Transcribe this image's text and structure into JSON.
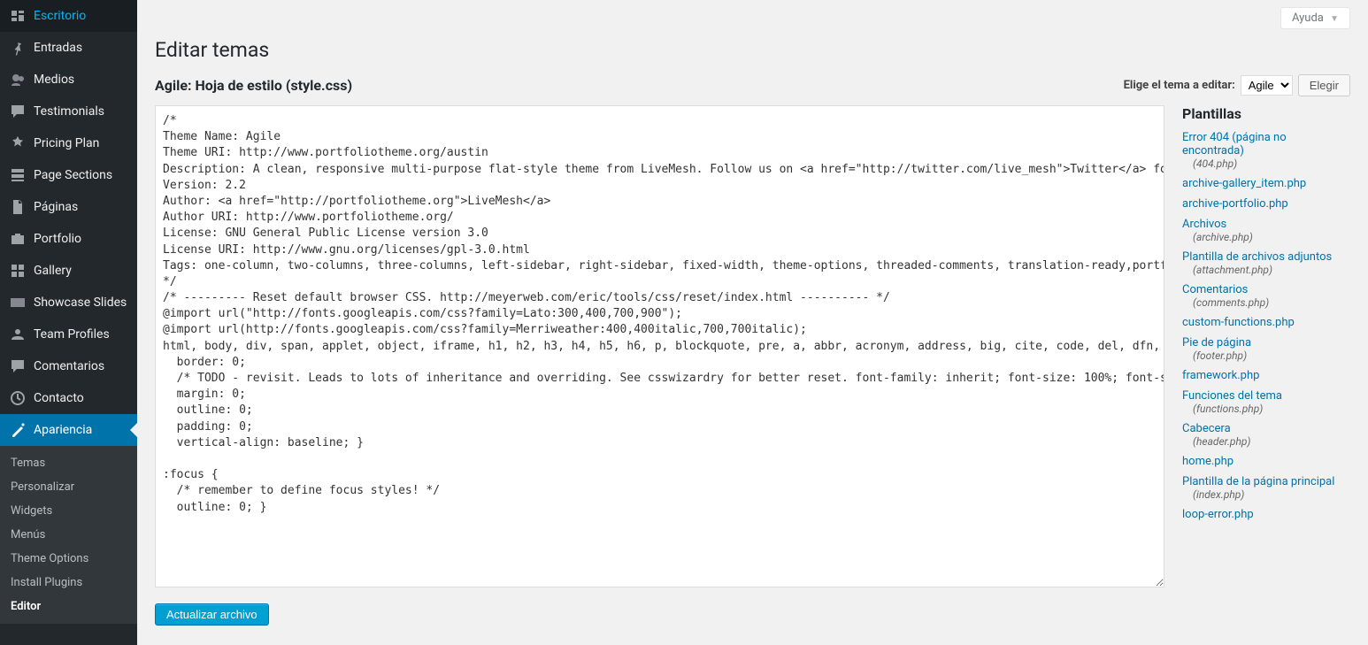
{
  "help_tab": "Ayuda",
  "page_title": "Editar temas",
  "file_heading": "Agile: Hoja de estilo (style.css)",
  "theme_selector": {
    "label": "Elige el tema a editar:",
    "selected": "Agile",
    "button": "Elegir"
  },
  "editor_content": "/*\nTheme Name: Agile\nTheme URI: http://www.portfoliotheme.org/austin\nDescription: A clean, responsive multi-purpose flat-style theme from LiveMesh. Follow us on <a href=\"http://twitter.com/live_mesh\">Twitter</a> for updates\nVersion: 2.2\nAuthor: <a href=\"http://portfoliotheme.org\">LiveMesh</a>\nAuthor URI: http://www.portfoliotheme.org/\nLicense: GNU General Public License version 3.0\nLicense URI: http://www.gnu.org/licenses/gpl-3.0.html\nTags: one-column, two-columns, three-columns, left-sidebar, right-sidebar, fixed-width, theme-options, threaded-comments, translation-ready,portfolio,mobile,app,one-page,single-page,ios,android,tags\n*/\n/* --------- Reset default browser CSS. http://meyerweb.com/eric/tools/css/reset/index.html ---------- */\n@import url(\"http://fonts.googleapis.com/css?family=Lato:300,400,700,900\");\n@import url(http://fonts.googleapis.com/css?family=Merriweather:400,400italic,700,700italic);\nhtml, body, div, span, applet, object, iframe, h1, h2, h3, h4, h5, h6, p, blockquote, pre, a, abbr, acronym, address, big, cite, code, del, dfn, em, font, ins, kbd, q, s, samp, small, strike, strong, sub, sup, tt, var, dl, dt, dd, ol, ul, li, fieldset, form, label, legend, table, caption, tbody, tfoot, thead, tr, th, td, article, aside, canvas, details, figcaption, figure, footer, header, hgroup, menu, nav, section, summary, time, mark, audio, video {\n  border: 0;\n  /* TODO - revisit. Leads to lots of inheritance and overriding. See csswizardry for better reset. font-family: inherit; font-size: 100%; font-style: inherit; font-weight: inherit; */\n  margin: 0;\n  outline: 0;\n  padding: 0;\n  vertical-align: baseline; }\n\n:focus {\n  /* remember to define focus styles! */\n  outline: 0; }",
  "update_button": "Actualizar archivo",
  "sidebar": {
    "items": [
      {
        "label": "Escritorio",
        "icon": "dashboard"
      },
      {
        "label": "Entradas",
        "icon": "pin"
      },
      {
        "label": "Medios",
        "icon": "media"
      },
      {
        "label": "Testimonials",
        "icon": "testimonial"
      },
      {
        "label": "Pricing Plan",
        "icon": "pricing"
      },
      {
        "label": "Page Sections",
        "icon": "sections"
      },
      {
        "label": "Páginas",
        "icon": "page"
      },
      {
        "label": "Portfolio",
        "icon": "portfolio"
      },
      {
        "label": "Gallery",
        "icon": "gallery"
      },
      {
        "label": "Showcase Slides",
        "icon": "slides"
      },
      {
        "label": "Team Profiles",
        "icon": "team"
      },
      {
        "label": "Comentarios",
        "icon": "comments"
      },
      {
        "label": "Contacto",
        "icon": "contact"
      },
      {
        "label": "Apariencia",
        "icon": "appearance",
        "current": true
      }
    ],
    "submenu": [
      {
        "label": "Temas"
      },
      {
        "label": "Personalizar"
      },
      {
        "label": "Widgets"
      },
      {
        "label": "Menús"
      },
      {
        "label": "Theme Options"
      },
      {
        "label": "Install Plugins"
      },
      {
        "label": "Editor",
        "current": true
      }
    ]
  },
  "templates": {
    "heading": "Plantillas",
    "items": [
      {
        "label": "Error 404 (página no encontrada)",
        "file": "(404.php)"
      },
      {
        "label": "archive-gallery_item.php"
      },
      {
        "label": "archive-portfolio.php"
      },
      {
        "label": "Archivos",
        "file": "(archive.php)"
      },
      {
        "label": "Plantilla de archivos adjuntos",
        "file": "(attachment.php)"
      },
      {
        "label": "Comentarios",
        "file": "(comments.php)"
      },
      {
        "label": "custom-functions.php"
      },
      {
        "label": "Pie de página",
        "file": "(footer.php)"
      },
      {
        "label": "framework.php"
      },
      {
        "label": "Funciones del tema",
        "file": "(functions.php)"
      },
      {
        "label": "Cabecera",
        "file": "(header.php)"
      },
      {
        "label": "home.php"
      },
      {
        "label": "Plantilla de la página principal",
        "file": "(index.php)"
      },
      {
        "label": "loop-error.php"
      }
    ]
  }
}
